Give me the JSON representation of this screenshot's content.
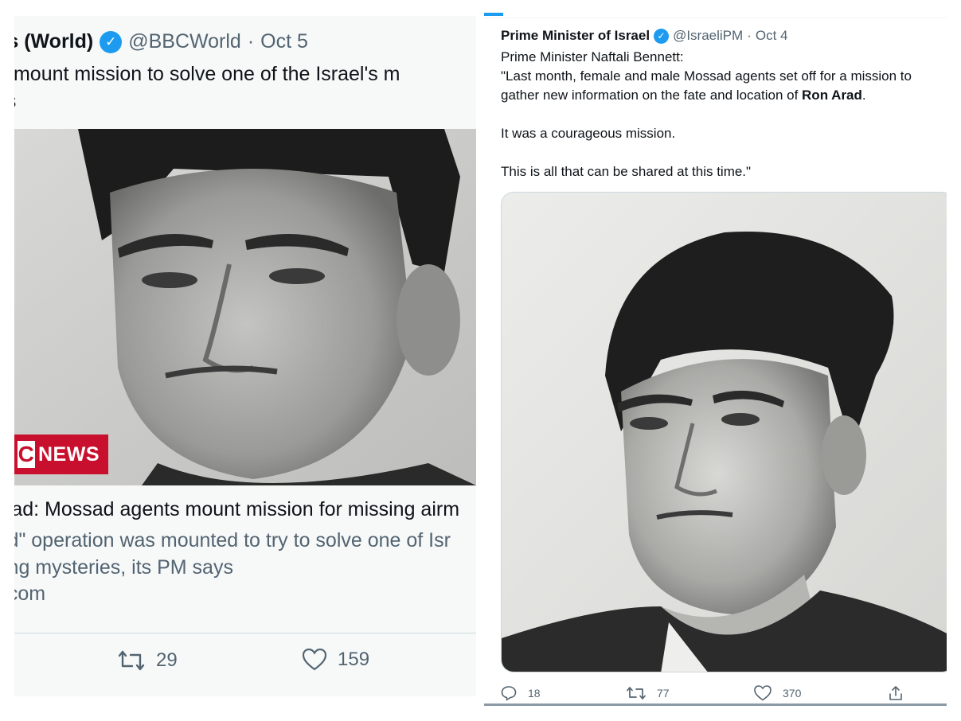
{
  "left_tweet": {
    "name": "ews (World)",
    "handle": "@BBCWorld",
    "separator": "·",
    "date": "Oct 5",
    "text_line1": " agents mount mission to solve one of the Israel's m",
    "text_line2": "es",
    "card": {
      "logo_text": "NEWS",
      "logo_letter": "C",
      "title": "rad: Mossad agents mount mission for missing airm",
      "description_line1": "ld\" operation was mounted to try to solve one of Isr",
      "description_line2": "ing mysteries, its PM says",
      "domain": ":.com"
    },
    "actions": {
      "retweets": "29",
      "likes": "159"
    }
  },
  "right_tweet": {
    "name": "Prime Minister of Israel",
    "handle": "@IsraeliPM",
    "separator": "·",
    "date": "Oct 4",
    "text_before_bold": "Prime Minister Naftali Bennett:\n\"Last month, female and male Mossad agents set off for a mission to gather new information on the fate and location of ",
    "text_bold": "Ron Arad",
    "text_after_bold": ".\n\nIt was a courageous mission.\n\nThis is all that can be shared at this time.\"",
    "actions": {
      "replies": "18",
      "retweets": "77",
      "likes": "370"
    }
  },
  "colors": {
    "verified_blue": "#1d9bf0",
    "bbc_red": "#c8102e",
    "muted_text": "#536471"
  }
}
